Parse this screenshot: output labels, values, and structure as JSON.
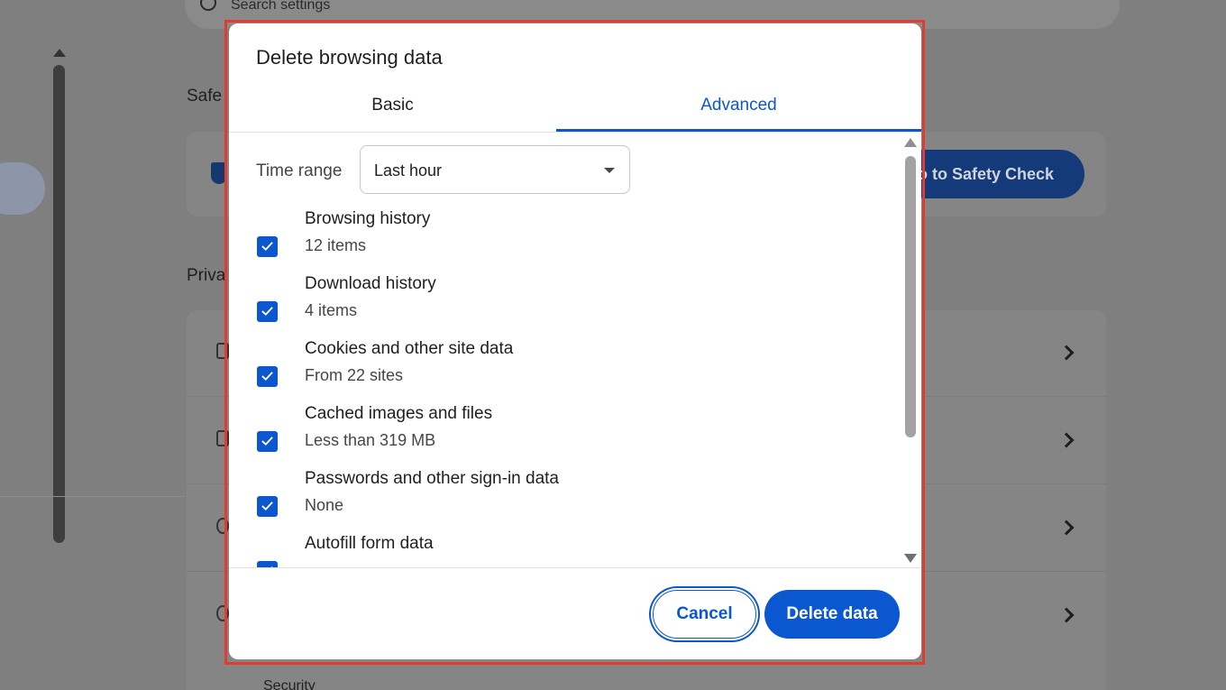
{
  "background": {
    "search_placeholder": "Search settings",
    "safety_label": "Safe",
    "privacy_label": "Priva",
    "safety_check_button": "o to Safety Check",
    "security_label": "Security"
  },
  "dialog": {
    "title": "Delete browsing data",
    "tabs": [
      {
        "label": "Basic",
        "selected": false
      },
      {
        "label": "Advanced",
        "selected": true
      }
    ],
    "time_range": {
      "label": "Time range",
      "value": "Last hour"
    },
    "items": [
      {
        "title": "Browsing history",
        "subtitle": "12 items",
        "checked": true
      },
      {
        "title": "Download history",
        "subtitle": "4 items",
        "checked": true
      },
      {
        "title": "Cookies and other site data",
        "subtitle": "From 22 sites",
        "checked": true
      },
      {
        "title": "Cached images and files",
        "subtitle": "Less than 319 MB",
        "checked": true
      },
      {
        "title": "Passwords and other sign-in data",
        "subtitle": "None",
        "checked": true
      },
      {
        "title": "Autofill form data",
        "subtitle": "",
        "checked": true
      }
    ],
    "buttons": {
      "cancel": "Cancel",
      "delete": "Delete data"
    }
  },
  "colors": {
    "accent": "#0b57d0",
    "highlight": "#e23c30",
    "overlay": "#7f7f7f"
  }
}
